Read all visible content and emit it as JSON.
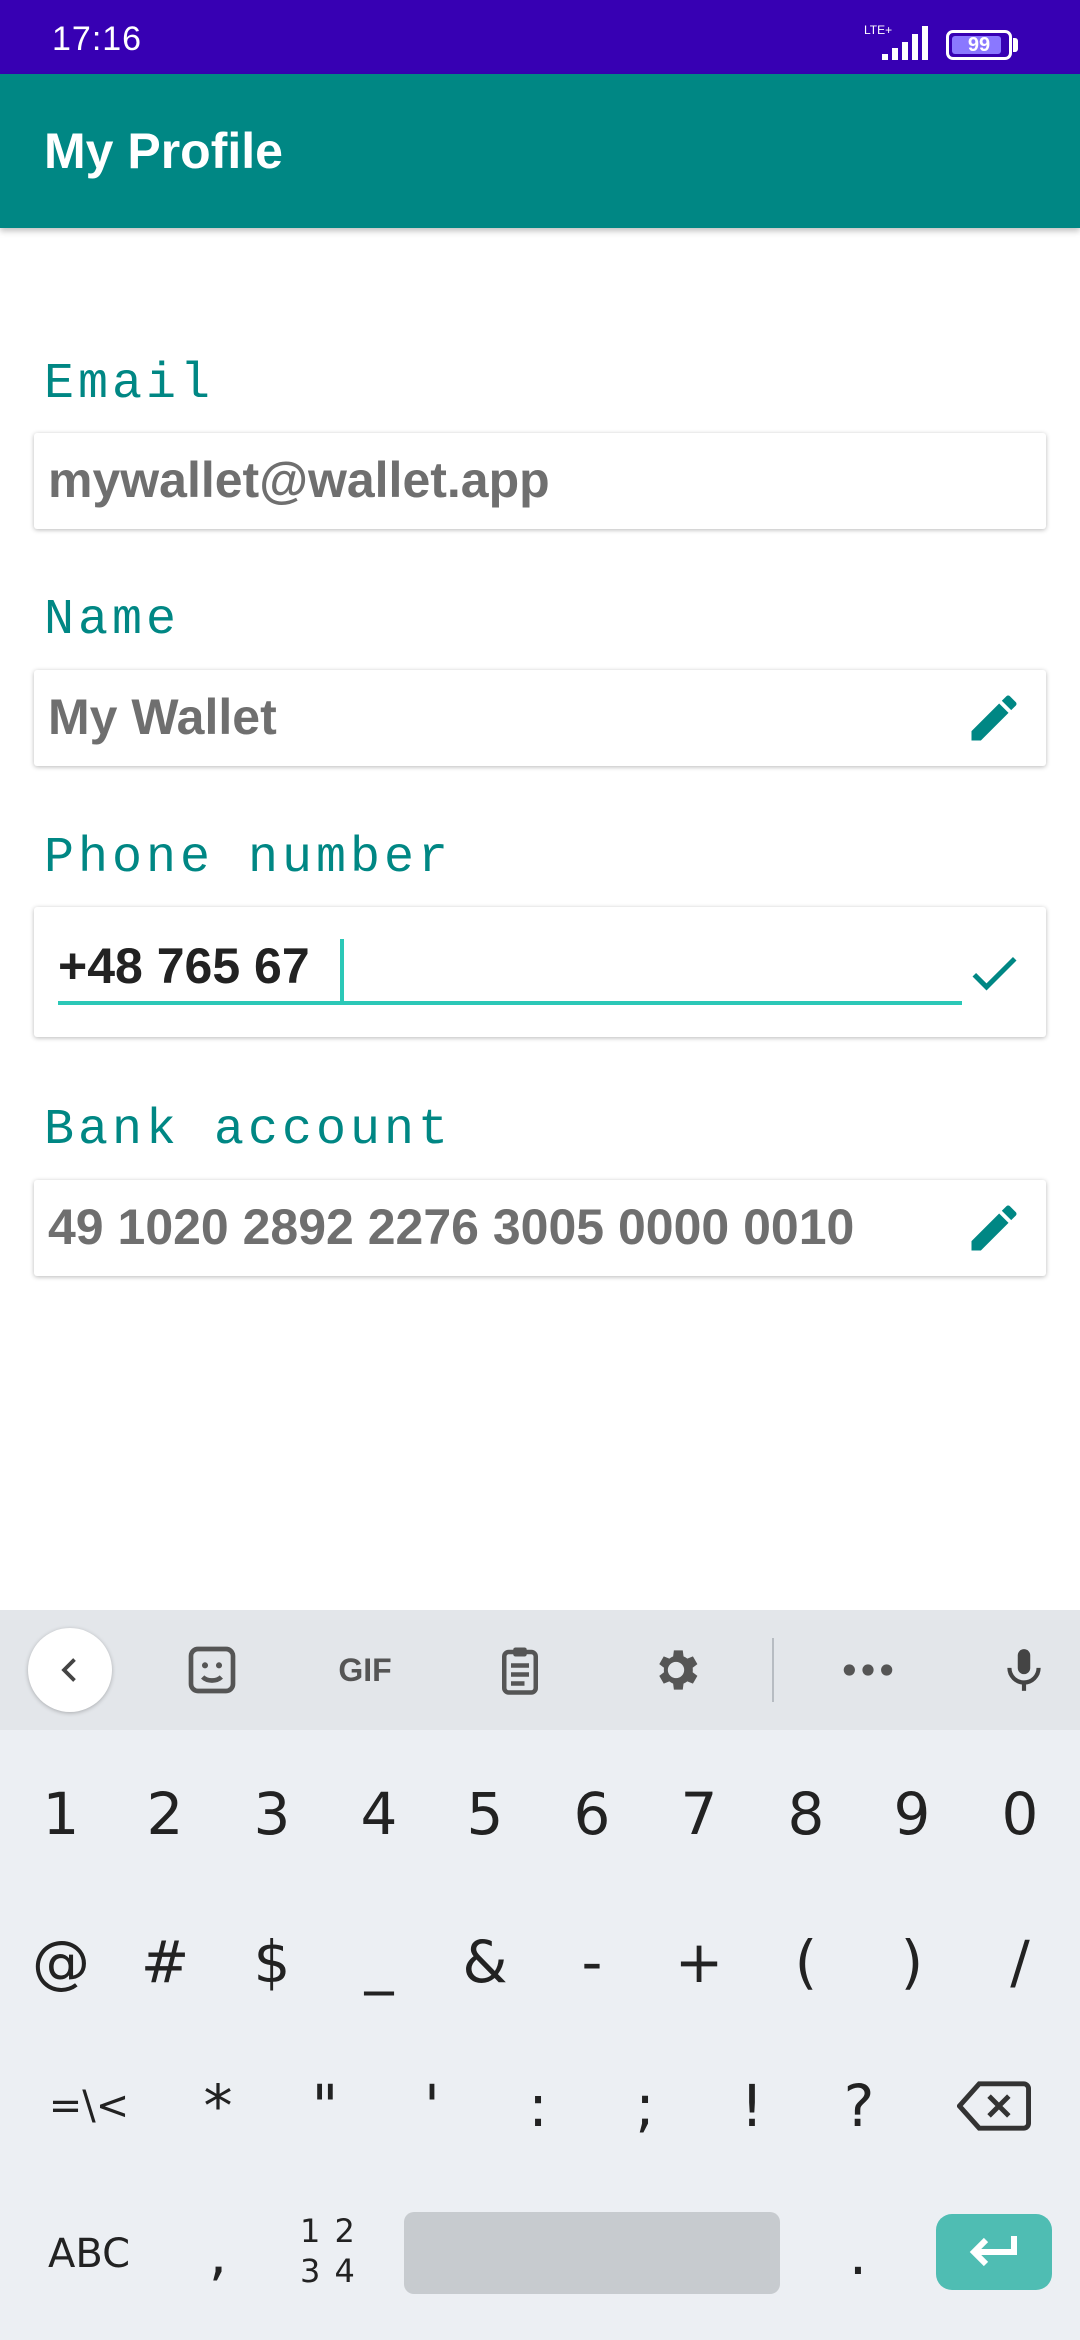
{
  "status_bar": {
    "time": "17:16",
    "network": "LTE+",
    "battery": "99"
  },
  "app_bar": {
    "title": "My Profile"
  },
  "colors": {
    "primary": "#008784",
    "status": "#3700b3",
    "accent": "#2bc8b7"
  },
  "fields": {
    "email": {
      "label": "Email",
      "value": "mywallet@wallet.app"
    },
    "name": {
      "label": "Name",
      "value": "My Wallet",
      "action_icon": "edit-icon"
    },
    "phone": {
      "label": "Phone number",
      "value": "+48 765 67",
      "action_icon": "check-icon"
    },
    "bank": {
      "label": "Bank account",
      "value": "49 1020 2892 2276 3005 0000 0010",
      "action_icon": "edit-icon"
    }
  },
  "keyboard": {
    "toolbar": {
      "gif": "GIF",
      "icons": [
        "back-icon",
        "sticker-icon",
        "gif-icon",
        "clipboard-icon",
        "settings-icon",
        "more-icon",
        "mic-icon"
      ]
    },
    "row1": [
      "1",
      "2",
      "3",
      "4",
      "5",
      "6",
      "7",
      "8",
      "9",
      "0"
    ],
    "row2": [
      "@",
      "#",
      "$",
      "_",
      "&",
      "-",
      "+",
      "(",
      ")",
      "/"
    ],
    "row3": [
      "=\\<",
      "*",
      "\"",
      "'",
      ":",
      ";",
      "!",
      "?"
    ],
    "row4": {
      "abc": "ABC",
      "comma": ",",
      "numpad_top": "1 2",
      "numpad_bottom": "3 4",
      "period": "."
    }
  }
}
